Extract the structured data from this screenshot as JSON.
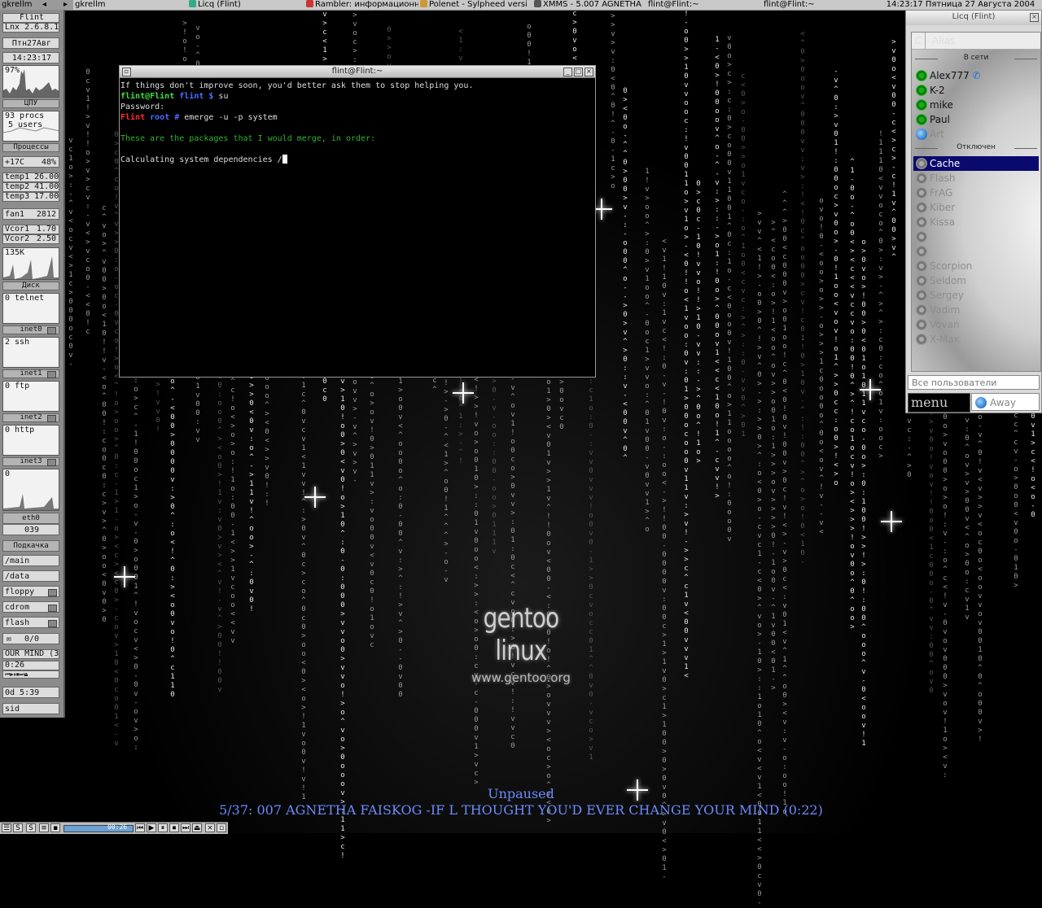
{
  "taskbar": {
    "items": [
      {
        "label": "gkrellm",
        "icon": "app-icon"
      },
      {
        "label": "gkrellm",
        "icon": "app-icon"
      },
      {
        "label": "Licq (Flint)",
        "icon": "licq-icon"
      },
      {
        "label": "Rambler: информационн",
        "icon": "browser-icon"
      },
      {
        "label": "Polenet - Sylpheed versi",
        "icon": "mail-icon"
      },
      {
        "label": "XMMS - 5.007 AGNETHA",
        "icon": "xmms-icon"
      },
      {
        "label": "flint@Flint:~",
        "icon": "terminal-icon"
      },
      {
        "label": "flint@Flint:~",
        "icon": "terminal-icon"
      }
    ],
    "clock": "14:23:17 Пятница 27 Августа 2004"
  },
  "gkrellm": {
    "host": "Flint",
    "kernel": "Lnx 2.6.8.1",
    "date": "Птн27Авг",
    "time": "14:23:17",
    "cpu_value": "97%",
    "cpu_label": "ЦПУ",
    "procs": "93 procs",
    "users": "5 users",
    "procs_label": "Процессы",
    "temp_cpu": "+17C",
    "temp_pct": "48%",
    "temp1": "temp1 26.00",
    "temp2": "temp2 41.00",
    "temp3": "temp3 17.00",
    "fan1_label": "fan1",
    "fan1_value": "2812",
    "vcor1_label": "Vcor1",
    "vcor1_value": "1.70",
    "vcor2_label": "Vcor2",
    "vcor2_value": "2.50",
    "disk_value": "135K",
    "disk_label": "Диск",
    "net": [
      {
        "graph": "0 telnet",
        "label": "inet0"
      },
      {
        "graph": "2 ssh",
        "label": "inet1"
      },
      {
        "graph": "0 ftp",
        "label": "inet2"
      },
      {
        "graph": "0 http",
        "label": "inet3"
      }
    ],
    "eth_graph": "0",
    "eth_label": "eth0",
    "mail_count": "039",
    "download_label": "Подкачка",
    "mounts": [
      "/main",
      "/data",
      "floppy",
      "cdrom",
      "flash"
    ],
    "mail_label": "0/0",
    "xmms_title": "OUR MIND (3",
    "xmms_time": "0:26",
    "uptime": "0d   5:39",
    "user": "sid"
  },
  "terminal": {
    "title": "flint@Flint:~",
    "lines": {
      "l1": "If things don't improve soon, you'd better ask them to stop helping you.",
      "l2_user": "flint@Flint",
      "l2_dir": " flint $",
      "l2_cmd": " su",
      "l3": "Password:",
      "l4_host": "Flint",
      "l4_dir": " root #",
      "l4_cmd": " emerge -u -p system",
      "l6": "These are the packages that I would merge, in order:",
      "l8": "Calculating system dependencies /"
    }
  },
  "licq": {
    "title": "Licq (Flint)",
    "column_c": "C",
    "column_alias": "Alias",
    "online_label": "В сети",
    "offline_label": "Отключен",
    "online": [
      "Alex777",
      "K-2",
      "mike",
      "Paul",
      "Art"
    ],
    "offline": [
      "Cache",
      "Flash",
      "FrAG",
      "Kiber",
      "Kissa",
      "",
      "",
      "Scorpion",
      "Seldom",
      "Sergey",
      "Vadim",
      "Vovan",
      "X-Max"
    ],
    "selected": "Cache",
    "filter": "Все пользователи",
    "menu_label": "menu",
    "status": "Away"
  },
  "desktop": {
    "logo_title": "gentoo linux",
    "logo_url": "www.gentoo.org"
  },
  "xmms_osd": {
    "status": "Unpaused",
    "track": "5/37: 007 AGNETHA FAISKOG -IF L THOUGHT YOU'D EVER CHANGE YOUR MIND (0:22)"
  },
  "bottom_bar": {
    "time": "00:26"
  }
}
